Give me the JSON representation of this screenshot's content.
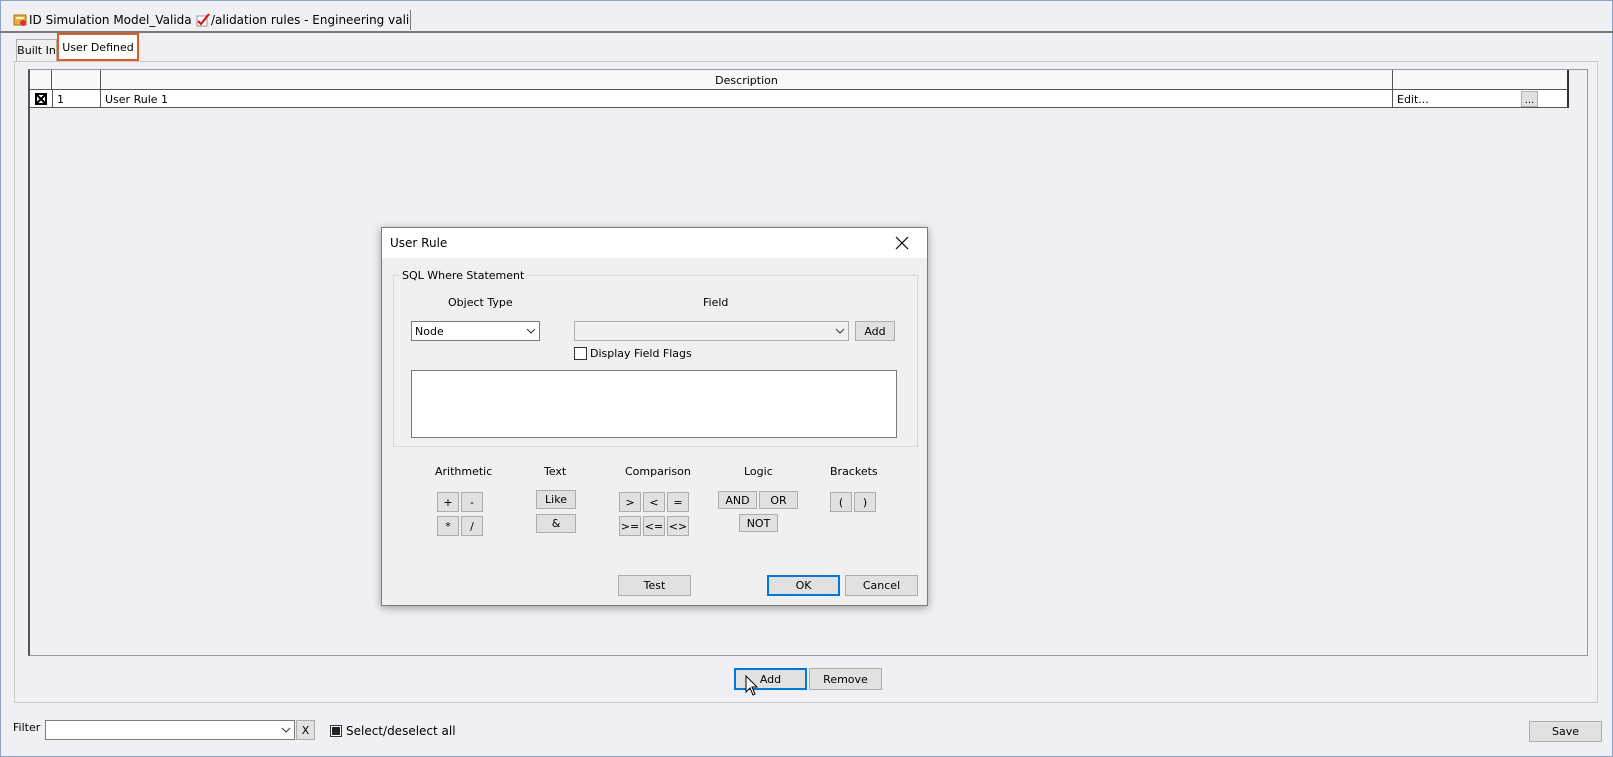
{
  "doc_tabs": [
    {
      "label": "ID Simulation Model_Validatior",
      "icon": "database-icon"
    },
    {
      "label": "/alidation rules - Engineering validatio",
      "icon": "checkmark-icon"
    }
  ],
  "tabs": [
    {
      "label": "Built In",
      "selected": false
    },
    {
      "label": "User Defined",
      "selected": true
    }
  ],
  "grid": {
    "columns": [
      "",
      "",
      "Description",
      ""
    ],
    "rows": [
      {
        "checked": true,
        "number": "1",
        "description": "User Rule 1",
        "edit": "Edit...",
        "ellipsis": "..."
      }
    ]
  },
  "main_buttons": {
    "add": "Add",
    "remove": "Remove"
  },
  "footer": {
    "filter_label": "Filter",
    "filter_value": "",
    "clear": "X",
    "select_all": "Select/deselect all",
    "save": "Save"
  },
  "dialog": {
    "title": "User Rule",
    "group_label": "SQL Where Statement",
    "object_type_label": "Object Type",
    "object_type_value": "Node",
    "field_label": "Field",
    "field_value": "",
    "add": "Add",
    "display_field_flags": "Display Field Flags",
    "sql_text": "",
    "sections": {
      "arithmetic": {
        "label": "Arithmetic",
        "buttons": [
          "+",
          "-",
          "*",
          "/"
        ]
      },
      "text": {
        "label": "Text",
        "buttons": [
          "Like",
          "&"
        ]
      },
      "comparison": {
        "label": "Comparison",
        "buttons": [
          ">",
          "<",
          "=",
          ">=",
          "<=",
          "<>"
        ]
      },
      "logic": {
        "label": "Logic",
        "buttons": [
          "AND",
          "OR",
          "NOT"
        ]
      },
      "brackets": {
        "label": "Brackets",
        "buttons": [
          "(",
          ")"
        ]
      }
    },
    "test": "Test",
    "ok": "OK",
    "cancel": "Cancel"
  },
  "colors": {
    "accent": "#0078d7",
    "tab_highlight": "#e05a26",
    "background": "#f0eff3"
  }
}
